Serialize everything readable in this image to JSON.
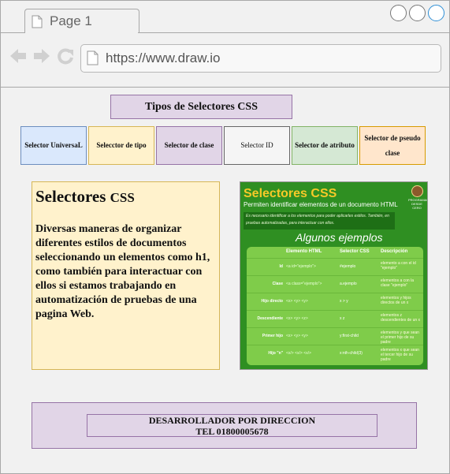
{
  "browser": {
    "tab_label": "Page 1",
    "url": "https://www.draw.io"
  },
  "title": "Tipos de Selectores CSS",
  "selectors": [
    {
      "label": "Selector UniversaL",
      "fill": "#dae8fc",
      "stroke": "#6c8ebf"
    },
    {
      "label": "Selecctor de tipo",
      "fill": "#fff2cc",
      "stroke": "#d6b656"
    },
    {
      "label": "Selector de clase",
      "fill": "#e1d5e7",
      "stroke": "#9673a6"
    },
    {
      "label": "Selector ID",
      "fill": "#f5f5f5",
      "stroke": "#666666"
    },
    {
      "label": "Selector de atributo",
      "fill": "#d5e8d4",
      "stroke": "#82b366"
    },
    {
      "label": "Selector de pseudo clase",
      "fill": "#ffe6cc",
      "stroke": "#d79b00"
    }
  ],
  "card": {
    "heading_main": "Selectores",
    "heading_small": "CSS",
    "body": "Diversas maneras de organizar diferentes estilos de documentos seleccionando un elementos como h1, como también para interactuar con ellos si estamos trabajando en automatización de pruebas de una pagina Web."
  },
  "image": {
    "title": "Selectores CSS",
    "subtitle": "Permiten identificar elementos de un documento HTML",
    "note": "Es necesario identificar a los elementos para poder aplicarles estilos. También, en pruebas automatizadas, para interactuar con ellos.",
    "examples_title": "Algunos ejemplos",
    "logo_text": "PROGRAMACIÓN DESDE CERO",
    "columns": [
      "Elemento HTML",
      "Selector CSS",
      "Descripción"
    ],
    "rows": [
      {
        "name": "Id",
        "html": "<a id=\"ejemplo\">",
        "css": "#ejemplo",
        "desc": "elemento a con el id \"ejemplo\""
      },
      {
        "name": "Clase",
        "html": "<a class=\"ejemplo\">",
        "css": "a.ejemplo",
        "desc": "elementos a con la clase \"ejemplo\""
      },
      {
        "name": "Hijo directo",
        "html": "<x> <y> <y>",
        "css": "x > y",
        "desc": "elementos y hijos directos de un x"
      },
      {
        "name": "Descendiente",
        "html": "<x> <y> <z>",
        "css": "x z",
        "desc": "elementos z descendientes de un x"
      },
      {
        "name": "Primer hijo",
        "html": "<x> <y> <y>",
        "css": "y:first-child",
        "desc": "elementos y que sean el primer hijo de su padre"
      },
      {
        "name": "Hijo \"n\"",
        "html": "<x/> <x/> <x/>",
        "css": "x:nth-child(3)",
        "desc": "elementos x que sean el tercer hijo de su padre"
      }
    ]
  },
  "footer": {
    "line1": "DESARROLLADOR POR DIRECCION",
    "line2": "TEL 01800005678"
  }
}
